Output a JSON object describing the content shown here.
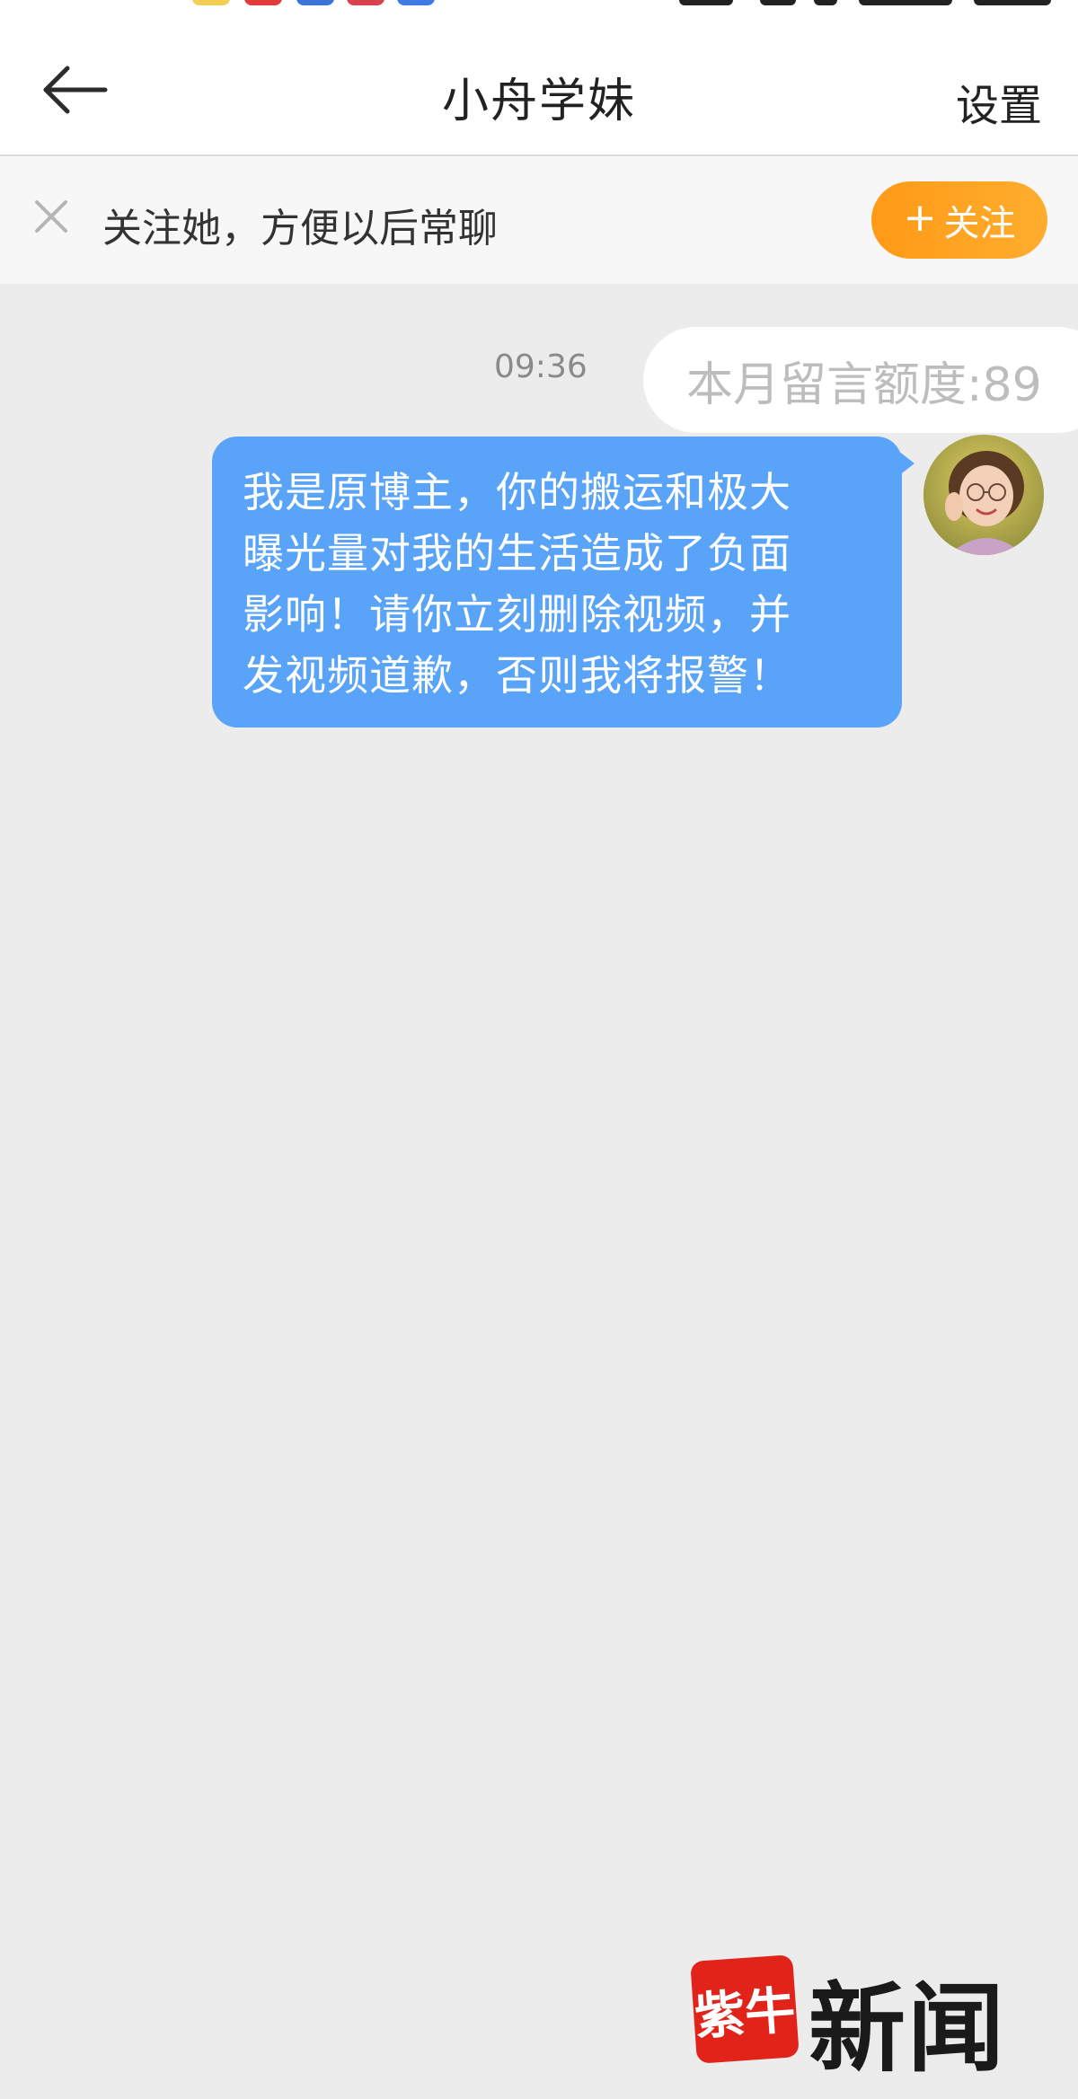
{
  "header": {
    "title": "小舟学妹",
    "settings_label": "设置",
    "back_icon": "arrow-left-icon"
  },
  "follow_bar": {
    "text": "关注她，方便以后常聊",
    "button_plus": "+",
    "button_label": "关注",
    "close_icon": "close-icon",
    "button_color": "#ff9f1f"
  },
  "chat": {
    "timestamp": "09:36",
    "quota_text": "本月留言额度:89",
    "message": {
      "lines": [
        "我是原博主，你的搬运和极大",
        "曝光量对我的生活造成了负面",
        "影响！请你立刻删除视频，并",
        "发视频道歉，否则我将报警！"
      ],
      "bubble_color": "#59a4f8"
    },
    "sender_avatar": "avatar"
  },
  "watermark": {
    "badge_text": "紫牛",
    "text": "新闻"
  }
}
